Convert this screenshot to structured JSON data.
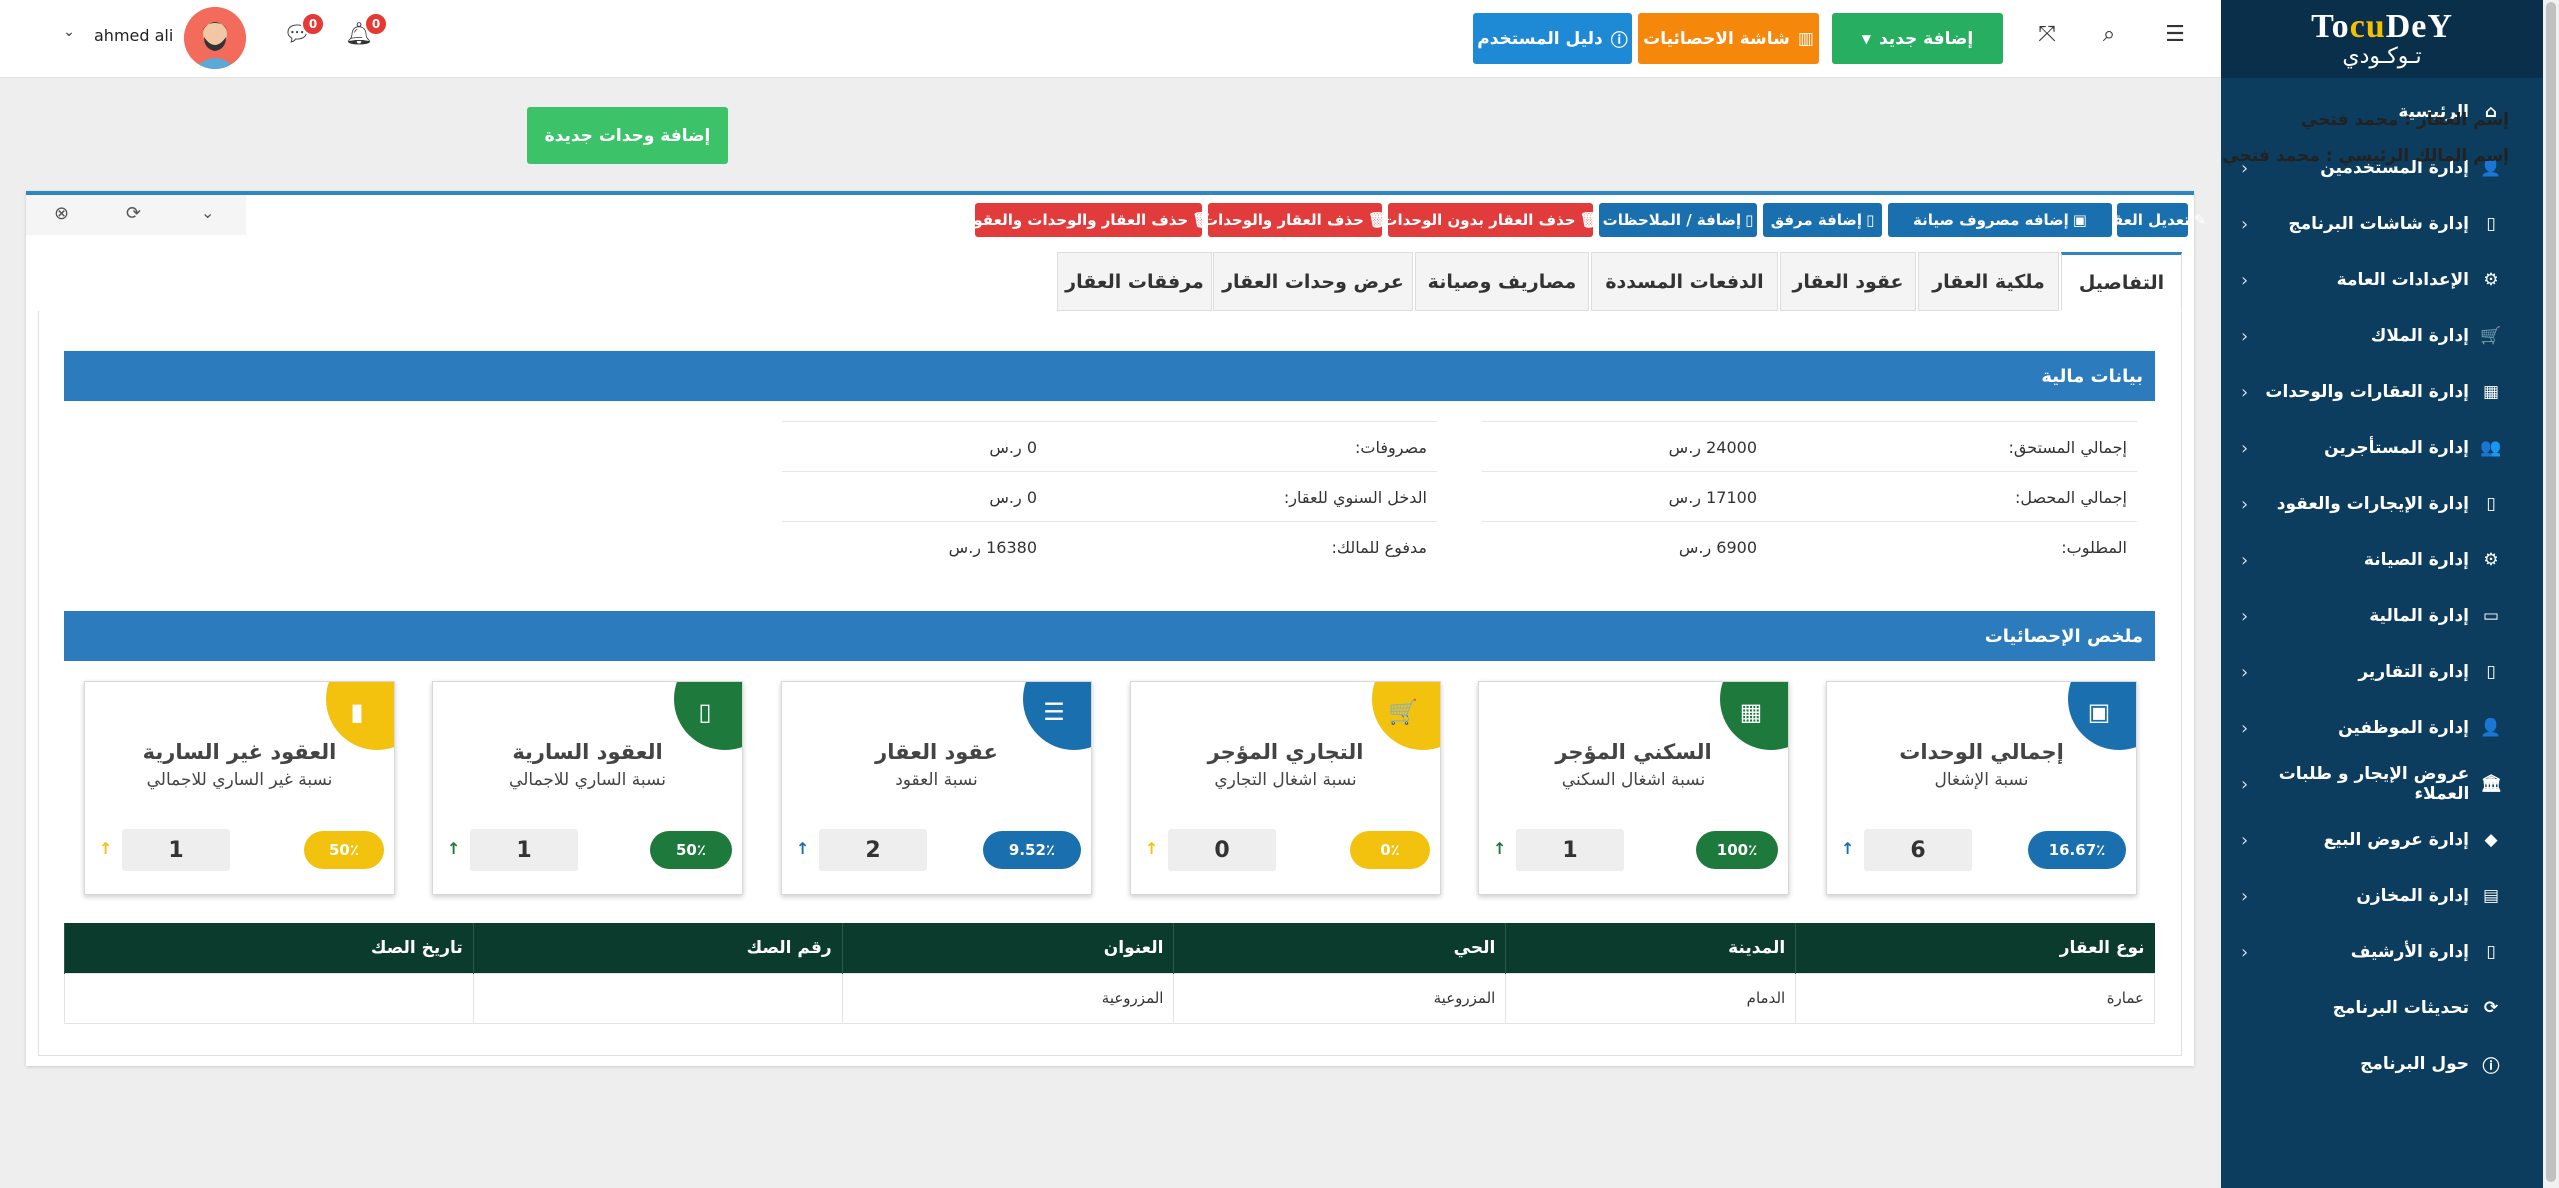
{
  "sidebar": {
    "logo_text_top": "TocuDeY",
    "logo_text_bottom": "تـوكـودي",
    "items": [
      {
        "label": "الرئيسية",
        "icon": "home-icon",
        "glyph": "⌂",
        "has_children": false
      },
      {
        "label": "إدارة المستخدمين",
        "icon": "user-plus-icon",
        "glyph": "👤",
        "has_children": true
      },
      {
        "label": "إدارة شاشات البرنامج",
        "icon": "file-icon",
        "glyph": "▯",
        "has_children": true
      },
      {
        "label": "الإعدادات العامة",
        "icon": "gear-icon",
        "glyph": "⚙",
        "has_children": true
      },
      {
        "label": "إدارة الملاك",
        "icon": "cart-icon",
        "glyph": "🛒",
        "has_children": true
      },
      {
        "label": "إدارة العقارات والوحدات",
        "icon": "building-icon",
        "glyph": "▦",
        "has_children": true
      },
      {
        "label": "إدارة المستأجرين",
        "icon": "users-icon",
        "glyph": "👥",
        "has_children": true
      },
      {
        "label": "إدارة الإيجارات والعقود",
        "icon": "document-icon",
        "glyph": "▯",
        "has_children": true
      },
      {
        "label": "إدارة الصيانة",
        "icon": "cogs-icon",
        "glyph": "⚙",
        "has_children": true
      },
      {
        "label": "إدارة المالية",
        "icon": "money-icon",
        "glyph": "▭",
        "has_children": true
      },
      {
        "label": "إدارة التقارير",
        "icon": "report-icon",
        "glyph": "▯",
        "has_children": true
      },
      {
        "label": "إدارة الموظفين",
        "icon": "employee-icon",
        "glyph": "👤",
        "has_children": true
      },
      {
        "label": "عروض الإيجار و طلبات العملاء",
        "icon": "bank-icon",
        "glyph": "🏛",
        "has_children": true
      },
      {
        "label": "إدارة عروض البيع",
        "icon": "tag-icon",
        "glyph": "◆",
        "has_children": true
      },
      {
        "label": "إدارة المخازن",
        "icon": "basket-icon",
        "glyph": "▤",
        "has_children": true
      },
      {
        "label": "إدارة الأرشيف",
        "icon": "archive-icon",
        "glyph": "▯",
        "has_children": true
      },
      {
        "label": "تحديثات البرنامج",
        "icon": "refresh-icon",
        "glyph": "⟳",
        "has_children": false
      },
      {
        "label": "حول البرنامج",
        "icon": "info-icon",
        "glyph": "ⓘ",
        "has_children": false
      }
    ]
  },
  "topbar": {
    "add_new_label": "إضافة جديد",
    "stats_label": "شاشة الاحصائيات",
    "guide_label": "دليل المستخدم",
    "notifications_count": "0",
    "messages_count": "0",
    "user_name": "ahmed ali",
    "colors": {
      "add_new": "#27ae60",
      "stats": "#f5870a",
      "guide": "#1e8ad6"
    }
  },
  "property": {
    "name_line": "إسم العقار : محمد فتحي",
    "owner_line": "إسم المالك الرئيسي : محمد فتحي",
    "add_units_label": "إضافة وحدات جديدة"
  },
  "actions": [
    {
      "label": "تعديل العقار",
      "color": "blue",
      "glyph": "✎"
    },
    {
      "label": "إضافه مصروف صيانة",
      "color": "blue",
      "glyph": "▣"
    },
    {
      "label": "إضافة مرفق",
      "color": "blue",
      "glyph": "▯"
    },
    {
      "label": "إضافة / الملاحظات",
      "color": "blue",
      "glyph": "▯"
    },
    {
      "label": "حذف العقار بدون الوحدات",
      "color": "red",
      "glyph": "🗑"
    },
    {
      "label": "حذف العقار والوحدات",
      "color": "red",
      "glyph": "🗑"
    },
    {
      "label": "حذف العقار والوحدات والعقود",
      "color": "red",
      "glyph": "🗑"
    }
  ],
  "tabs": [
    {
      "label": "التفاصيل",
      "active": true
    },
    {
      "label": "ملكية العقار",
      "active": false
    },
    {
      "label": "عقود العقار",
      "active": false
    },
    {
      "label": "الدفعات المسددة",
      "active": false
    },
    {
      "label": "مصاريف وصيانة",
      "active": false
    },
    {
      "label": "عرض وحدات العقار",
      "active": false
    },
    {
      "label": "مرفقات العقار",
      "active": false
    }
  ],
  "financial": {
    "title": "بيانات مالية",
    "right": [
      {
        "label": "إجمالي المستحق:",
        "value": "24000 ر.س"
      },
      {
        "label": "إجمالي المحصل:",
        "value": "17100 ر.س"
      },
      {
        "label": "المطلوب:",
        "value": "6900 ر.س"
      }
    ],
    "left": [
      {
        "label": "مصروفات:",
        "value": "0 ر.س"
      },
      {
        "label": "الدخل السنوي للعقار:",
        "value": "0 ر.س"
      },
      {
        "label": "مدفوع للمالك:",
        "value": "16380 ر.س"
      }
    ]
  },
  "stats": {
    "title": "ملخص الإحصائيات",
    "cards": [
      {
        "title": "إجمالي الوحدات",
        "subtitle": "نسبة الإشغال",
        "percent": "16.67٪",
        "count": "6",
        "color": "#1a6fae",
        "icon": "presentation-icon",
        "glyph": "▣"
      },
      {
        "title": "السكني المؤجر",
        "subtitle": "نسبة اشغال السكني",
        "percent": "100٪",
        "count": "1",
        "color": "#1e7a3c",
        "icon": "building-icon",
        "glyph": "▦"
      },
      {
        "title": "التجاري المؤجر",
        "subtitle": "نسبة اشغال التجاري",
        "percent": "0٪",
        "count": "0",
        "color": "#f2c20f",
        "icon": "cart-icon",
        "glyph": "🛒"
      },
      {
        "title": "عقود العقار",
        "subtitle": "نسبة العقود",
        "percent": "9.52٪",
        "count": "2",
        "color": "#1a6fae",
        "icon": "list-icon",
        "glyph": "☰"
      },
      {
        "title": "العقود السارية",
        "subtitle": "نسبة الساري للاجمالي",
        "percent": "50٪",
        "count": "1",
        "color": "#1e7a3c",
        "icon": "file-icon",
        "glyph": "▯"
      },
      {
        "title": "العقود غير السارية",
        "subtitle": "نسبة غير الساري للاجمالي",
        "percent": "50٪",
        "count": "1",
        "color": "#f2c20f",
        "icon": "file-icon",
        "glyph": "▮"
      }
    ]
  },
  "table": {
    "headers": [
      "نوع العقار",
      "المدينة",
      "الحي",
      "العنوان",
      "رقم الصك",
      "تاريخ الصك"
    ],
    "rows": [
      [
        "عمارة",
        "الدمام",
        "المزروعية",
        "المزروعية",
        "",
        ""
      ]
    ]
  }
}
